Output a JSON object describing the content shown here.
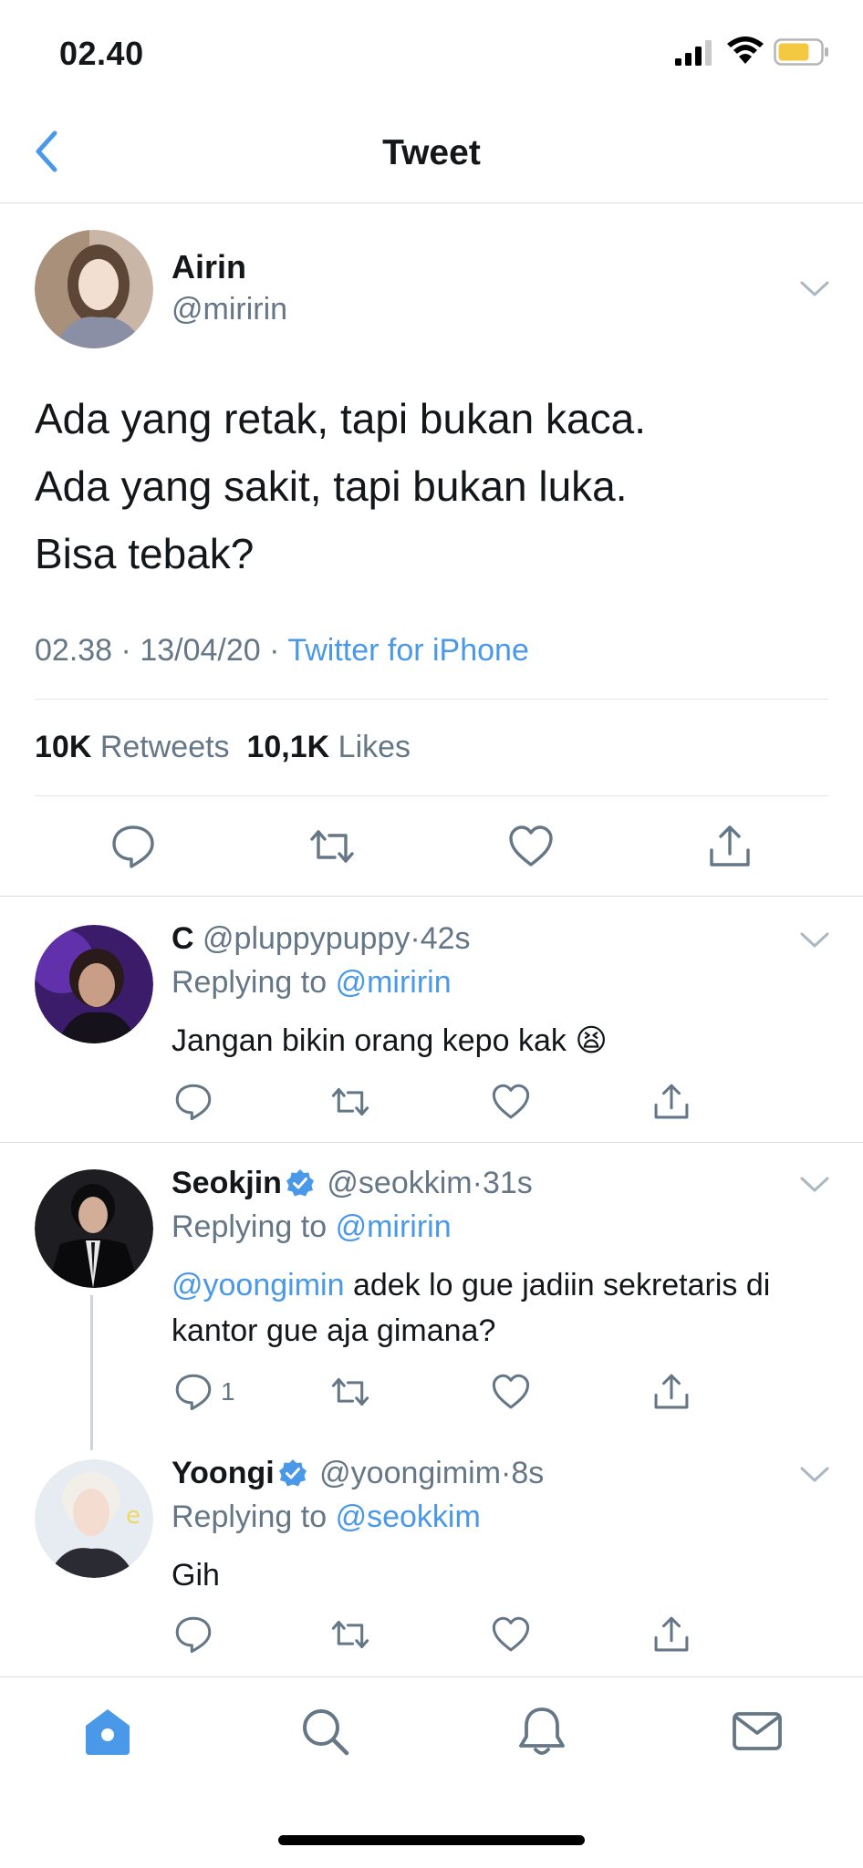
{
  "status_bar": {
    "time": "02.40"
  },
  "nav": {
    "title": "Tweet"
  },
  "main_tweet": {
    "name": "Airin",
    "handle": "@miririn",
    "lines": [
      "Ada yang retak, tapi bukan kaca.",
      "Ada yang sakit, tapi bukan luka.",
      "Bisa tebak?"
    ],
    "time": "02.38",
    "date": "13/04/20",
    "source": "Twitter for iPhone",
    "retweet_count": "10K",
    "retweet_label": "Retweets",
    "like_count": "10,1K",
    "like_label": "Likes"
  },
  "replies": [
    {
      "name": "C",
      "handle": "@pluppypuppy",
      "time": "42s",
      "replying_label": "Replying to",
      "replying_to": "@miririn",
      "mention": "",
      "text": "Jangan bikin orang kepo kak",
      "emoji": "😫",
      "reply_count": ""
    },
    {
      "name": "Seokjin",
      "handle": "@seokkim",
      "time": "31s",
      "replying_label": "Replying to",
      "replying_to": "@miririn",
      "mention": "@yoongimin",
      "text": "adek lo gue jadiin sekretaris di kantor gue aja gimana?",
      "reply_count": "1"
    },
    {
      "name": "Yoongi",
      "handle": "@yoongimim",
      "time": "8s",
      "replying_label": "Replying to",
      "replying_to": "@seokkim",
      "mention": "",
      "text": "Gih",
      "reply_count": ""
    }
  ],
  "separator": "·",
  "colors": {
    "accent": "#4a99e9",
    "secondary": "#657786",
    "primary_text": "#14171a",
    "battery": "#f5c842"
  },
  "icons": {
    "back": "chevron-left-icon",
    "reply": "reply-icon",
    "retweet": "retweet-icon",
    "like": "heart-icon",
    "share": "share-icon",
    "tabs": [
      "home-icon",
      "search-icon",
      "bell-icon",
      "mail-icon"
    ]
  }
}
